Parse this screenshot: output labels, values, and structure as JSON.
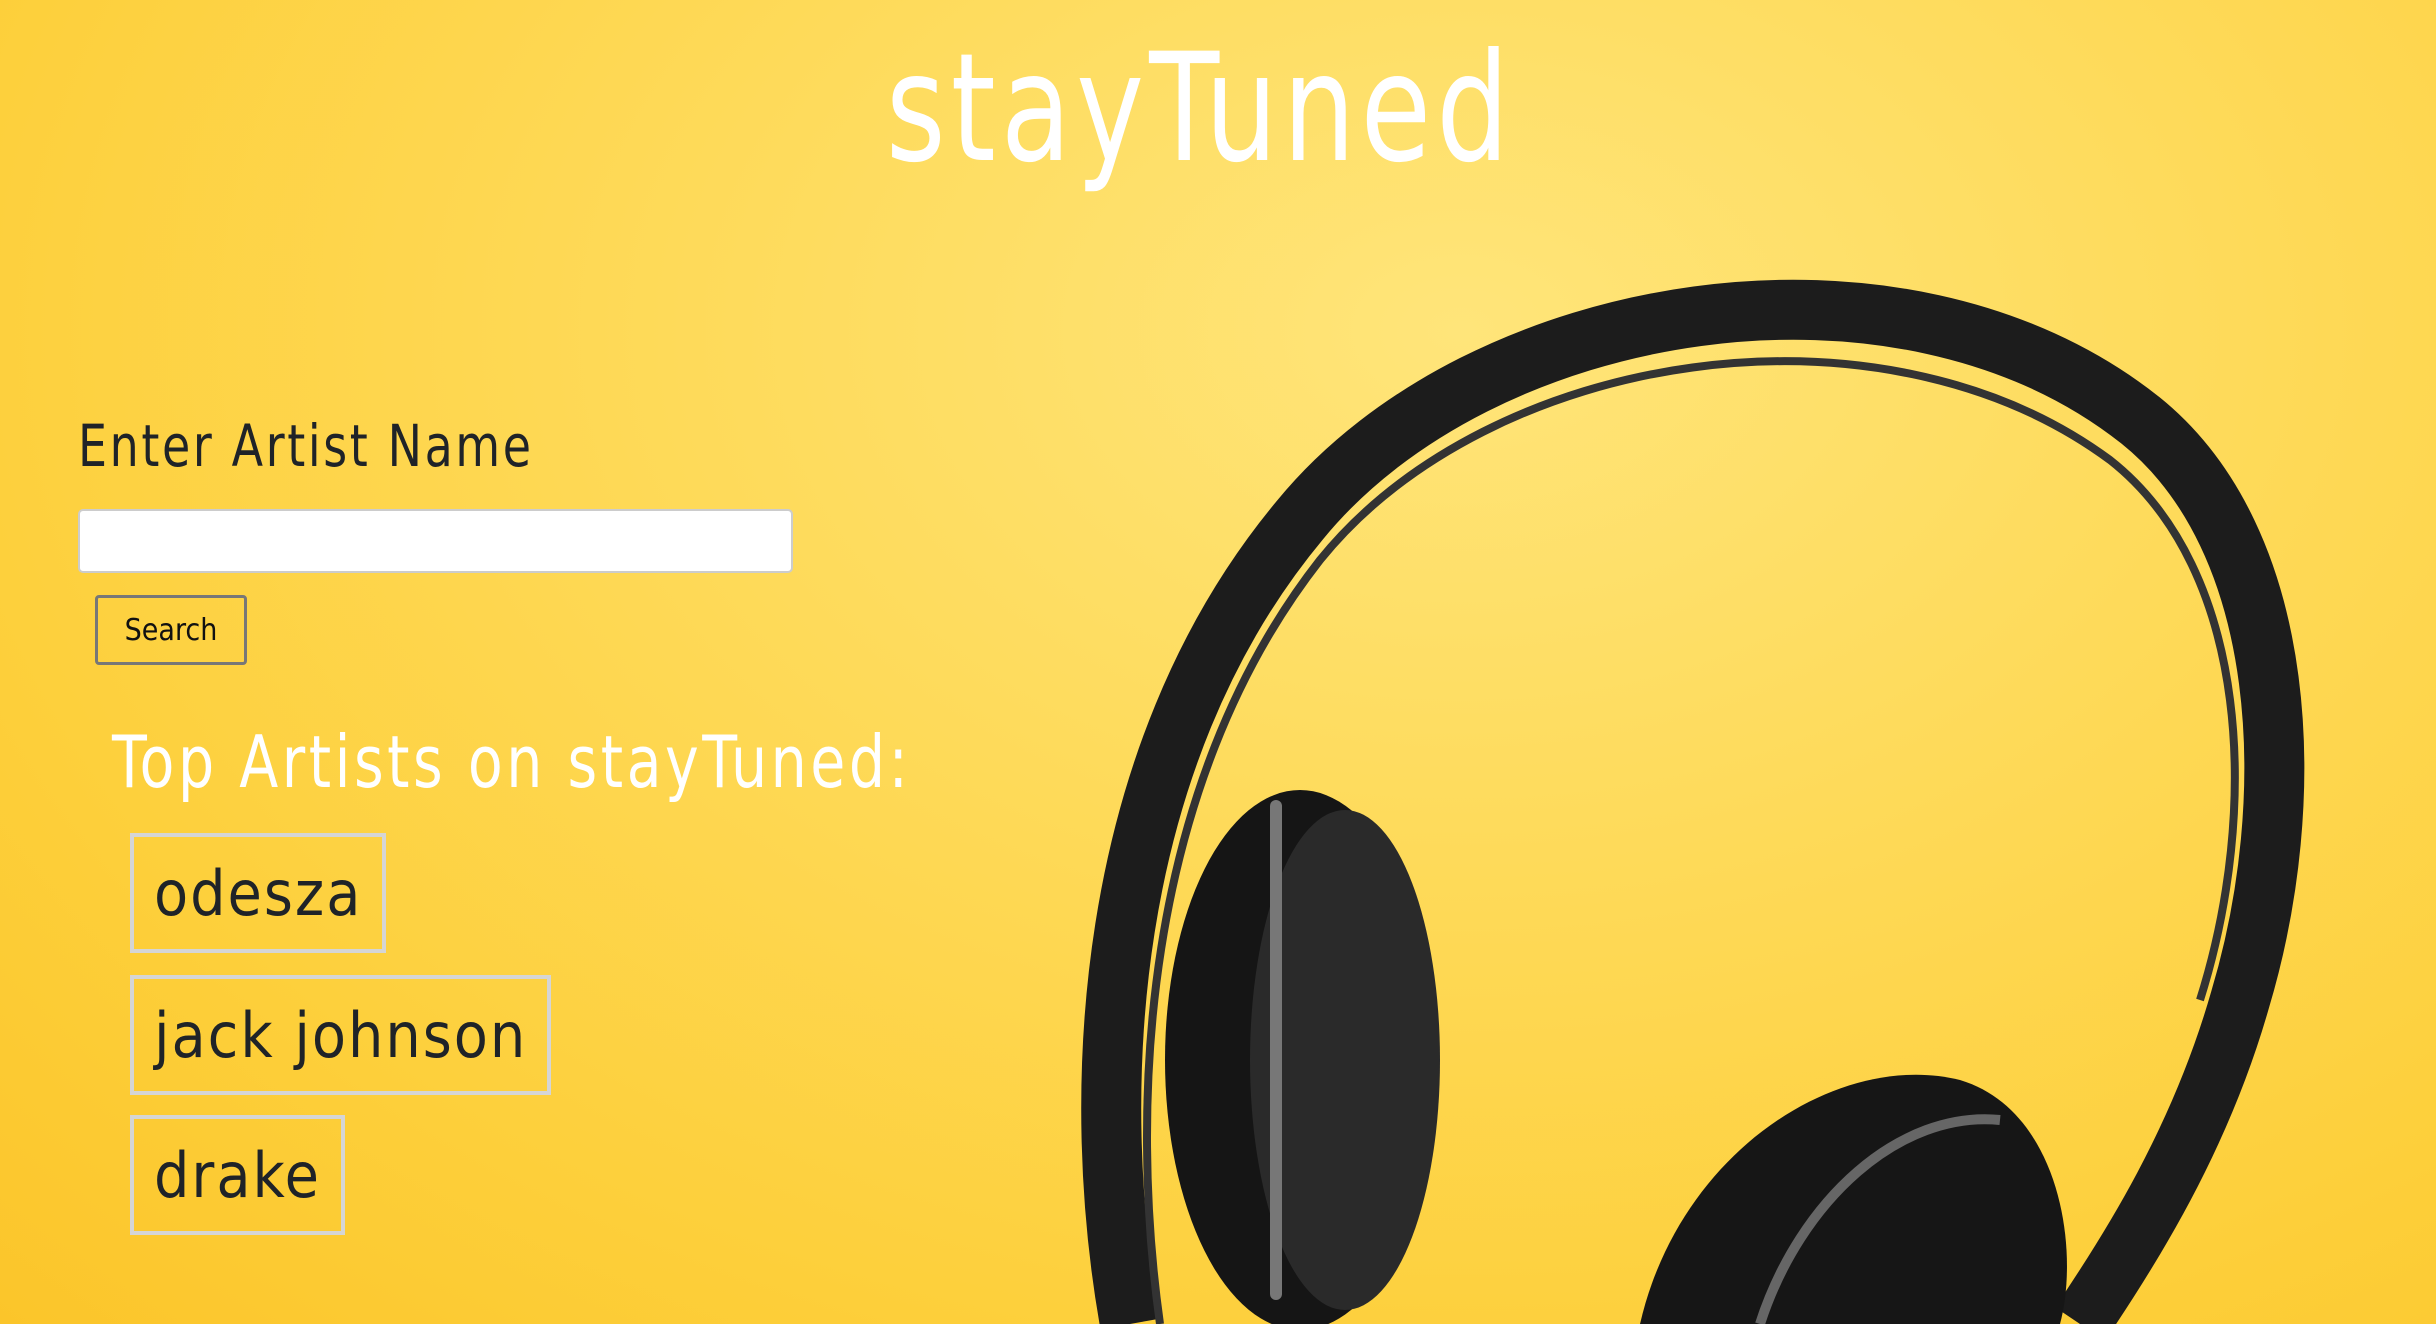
{
  "header": {
    "title": "stayTuned"
  },
  "search": {
    "label": "Enter Artist Name",
    "value": "",
    "placeholder": "",
    "button_label": "Search"
  },
  "top_artists": {
    "heading": "Top Artists on stayTuned:",
    "items": [
      {
        "name": "odesza"
      },
      {
        "name": "jack johnson"
      },
      {
        "name": "drake"
      }
    ]
  },
  "background": {
    "image": "headphones-icon",
    "color": "#fdd23a"
  }
}
